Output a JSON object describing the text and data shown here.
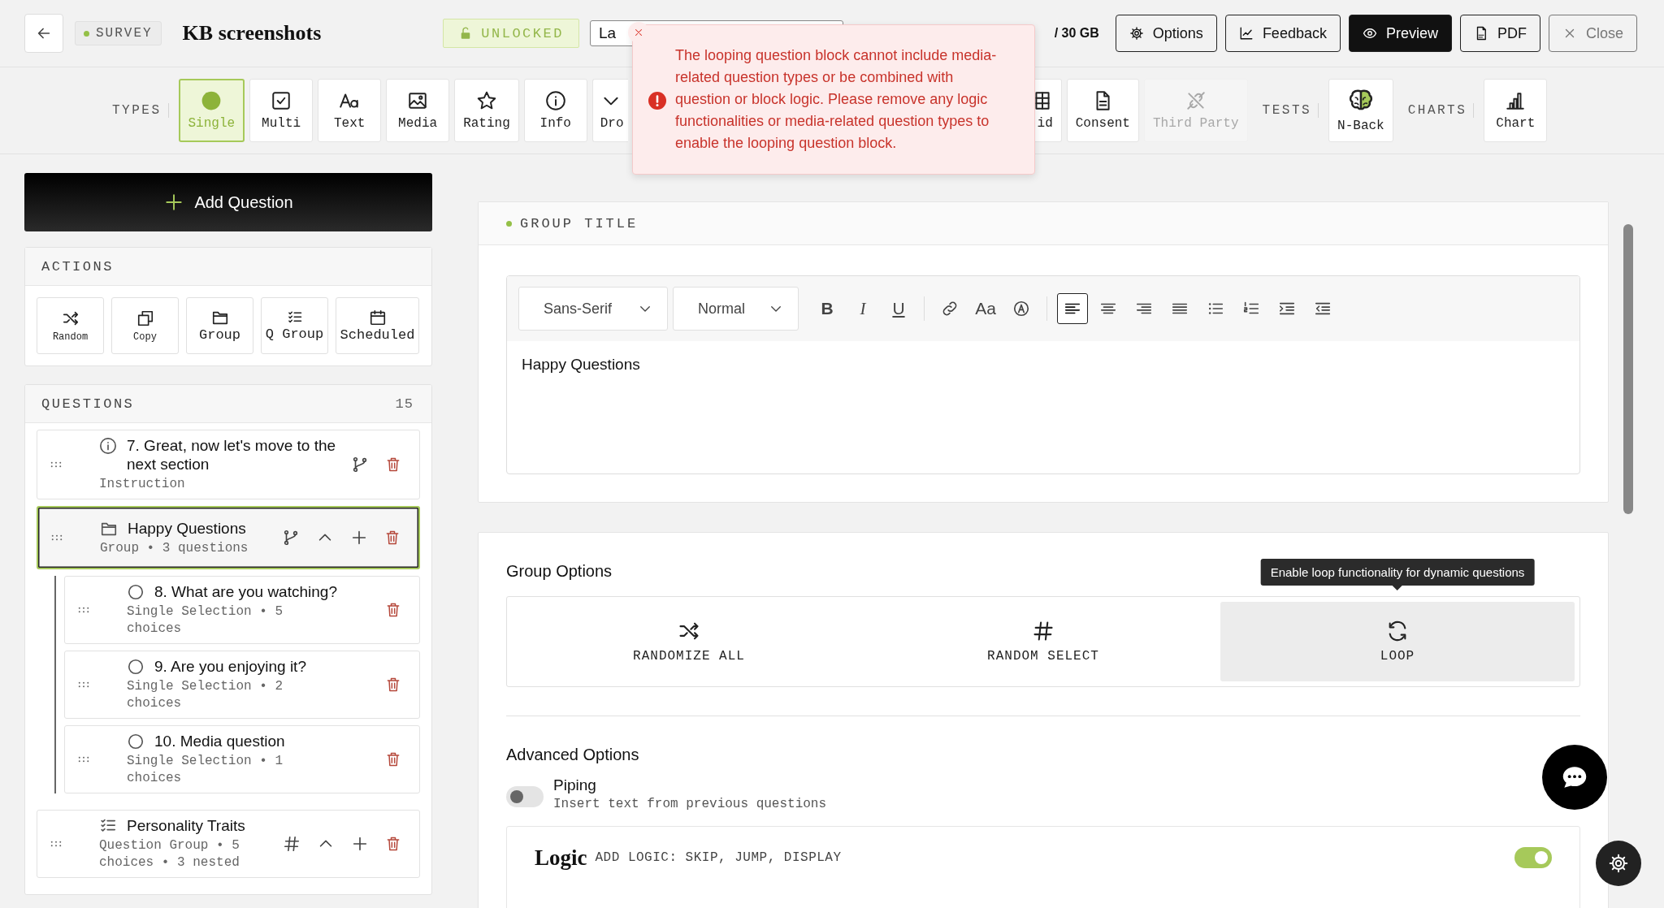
{
  "header": {
    "survey_badge": "SURVEY",
    "title": "KB screenshots",
    "lock_badge": "UNLOCKED",
    "language_field": {
      "value": "La"
    },
    "storage": "/ 30 GB",
    "buttons": [
      {
        "label": "Options",
        "kind": "outline"
      },
      {
        "label": "Feedback",
        "kind": "outline"
      },
      {
        "label": "Preview",
        "kind": "primary"
      },
      {
        "label": "PDF",
        "kind": "outline"
      },
      {
        "label": "Close",
        "kind": "muted"
      }
    ]
  },
  "toolbar": {
    "sections": [
      {
        "label": "TYPES",
        "tiles": [
          {
            "label": "Single",
            "selected": true,
            "disabled": false
          },
          {
            "label": "Multi",
            "selected": false,
            "disabled": false
          },
          {
            "label": "Text",
            "selected": false,
            "disabled": false
          },
          {
            "label": "Media",
            "selected": false,
            "disabled": false
          },
          {
            "label": "Rating",
            "selected": false,
            "disabled": false
          },
          {
            "label": "Info",
            "selected": false,
            "disabled": false
          },
          {
            "label": "Dro",
            "selected": false,
            "disabled": false
          },
          {
            "label": "id",
            "selected": false,
            "disabled": false
          },
          {
            "label": "Consent",
            "selected": false,
            "disabled": false
          },
          {
            "label": "Third Party",
            "selected": false,
            "disabled": true
          }
        ]
      },
      {
        "label": "TESTS",
        "tiles": [
          {
            "label": "N-Back",
            "selected": false,
            "disabled": false
          }
        ]
      },
      {
        "label": "CHARTS",
        "tiles": [
          {
            "label": "Chart",
            "selected": false,
            "disabled": false
          }
        ]
      }
    ]
  },
  "error_toast": {
    "message": "The looping question block cannot include media-related question types or be combined with question or block logic. Please remove any logic functionalities or media-related question types to enable the looping question block."
  },
  "sidebar": {
    "add_question_button": "Add Question",
    "actions": {
      "title": "ACTIONS",
      "buttons": [
        "Random",
        "Copy",
        "Group",
        "Q Group",
        "Scheduled"
      ]
    },
    "questions": {
      "title": "QUESTIONS",
      "count": "15",
      "items": [
        {
          "kind": "instruction",
          "title": "7. Great, now let's move to the next section",
          "subtitle": "Instruction",
          "selected": false
        },
        {
          "kind": "group",
          "title": "Happy Questions",
          "subtitle": "Group • 3 questions",
          "selected": true,
          "expanded": true,
          "children": [
            {
              "kind": "single",
              "title": "8. What are you watching?",
              "subtitle": "Single Selection • 5 choices",
              "selected": false
            },
            {
              "kind": "single",
              "title": "9. Are you enjoying it?",
              "subtitle": "Single Selection • 2 choices",
              "selected": false
            },
            {
              "kind": "single",
              "title": "10. Media question",
              "subtitle": "Single Selection • 1 choices",
              "selected": false
            }
          ]
        },
        {
          "kind": "question_group",
          "title": "Personality Traits",
          "subtitle": "Question Group • 5 choices • 3 nested",
          "selected": false,
          "expanded": true
        }
      ]
    }
  },
  "group_title_card": {
    "title": "GROUP TITLE",
    "editor": {
      "font": "Sans-Serif",
      "size": "Normal",
      "format_buttons": [
        {
          "label": "B",
          "kind": "bold"
        },
        {
          "label": "I",
          "kind": "italic"
        },
        {
          "label": "U",
          "kind": "underline"
        },
        {
          "label": "Aa",
          "kind": "size"
        }
      ],
      "align_buttons": [
        {
          "selected": true
        },
        {
          "selected": false
        },
        {
          "selected": false
        },
        {
          "selected": false
        },
        {
          "selected": false
        },
        {
          "selected": false
        },
        {
          "selected": false
        },
        {
          "selected": false
        }
      ],
      "content": "Happy Questions"
    }
  },
  "group_options": {
    "title": "Group Options",
    "tooltip": "Enable loop functionality for dynamic questions",
    "options": [
      {
        "label": "RANDOMIZE ALL",
        "hovered": false
      },
      {
        "label": "RANDOM SELECT",
        "hovered": false
      },
      {
        "label": "LOOP",
        "hovered": true
      }
    ]
  },
  "advanced_options": {
    "title": "Advanced Options",
    "piping": {
      "label": "Piping",
      "description": "Insert text from previous questions",
      "on": false
    },
    "logic": {
      "title": "Logic",
      "subtitle": "ADD LOGIC: SKIP, JUMP, DISPLAY",
      "on": true
    }
  }
}
